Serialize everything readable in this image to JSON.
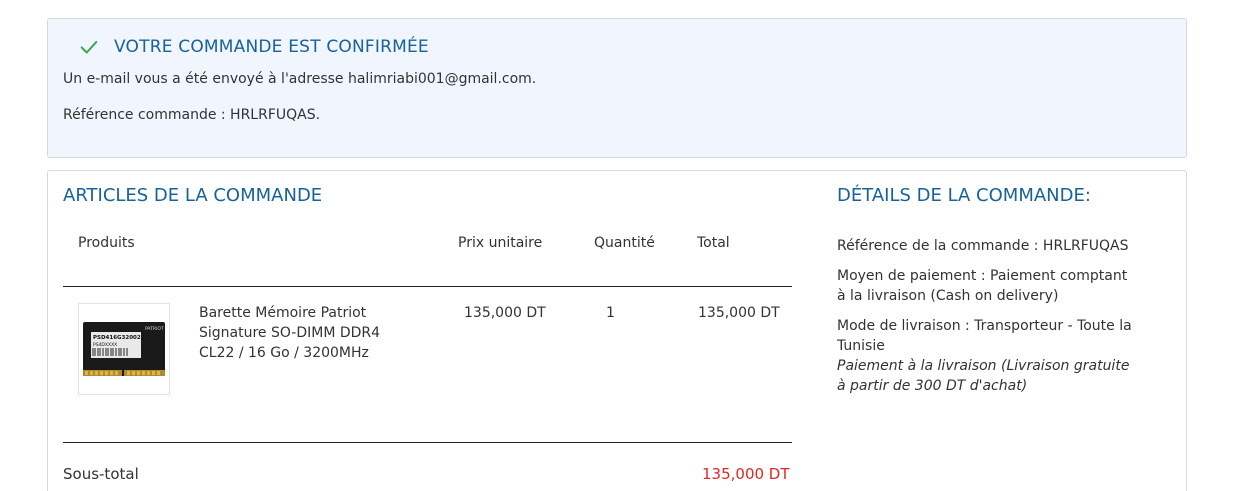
{
  "confirmation": {
    "title": "VOTRE COMMANDE EST CONFIRMÉE",
    "email_line": "Un e-mail vous a été envoyé à l'adresse halimriabi001@gmail.com.",
    "reference_line": "Référence commande : HRLRFUQAS.",
    "icon": "check-icon",
    "accent_color": "#17629b",
    "check_color": "#3aa757"
  },
  "items_section": {
    "title": "ARTICLES DE LA COMMANDE",
    "columns": {
      "product": "Produits",
      "unit_price": "Prix unitaire",
      "quantity": "Quantité",
      "total": "Total"
    },
    "rows": [
      {
        "name_line1": "Barette Mémoire Patriot",
        "name_line2": "Signature SO-DIMM DDR4",
        "name_line3": "CL22 / 16 Go / 3200MHz",
        "unit_price": "135,000 DT",
        "quantity": "1",
        "total": "135,000 DT",
        "image_text": {
          "brand": "PATRIOT",
          "code1": "PSD416G32002S",
          "code2": "PS4DXXXX"
        }
      }
    ],
    "subtotal_label": "Sous-total",
    "subtotal_value": "135,000 DT",
    "subtotal_color": "#e12626"
  },
  "details_section": {
    "title": "DÉTAILS DE LA COMMANDE:",
    "reference": "Référence de la commande : HRLRFUQAS",
    "payment_line1": "Moyen de paiement : Paiement comptant",
    "payment_line2": "à la livraison (Cash on delivery)",
    "delivery_line1": "Mode de livraison : Transporteur - Toute la",
    "delivery_line2": "Tunisie",
    "delivery_note_line1": "Paiement à la livraison (Livraison gratuite",
    "delivery_note_line2": "à partir de 300 DT d'achat)"
  }
}
